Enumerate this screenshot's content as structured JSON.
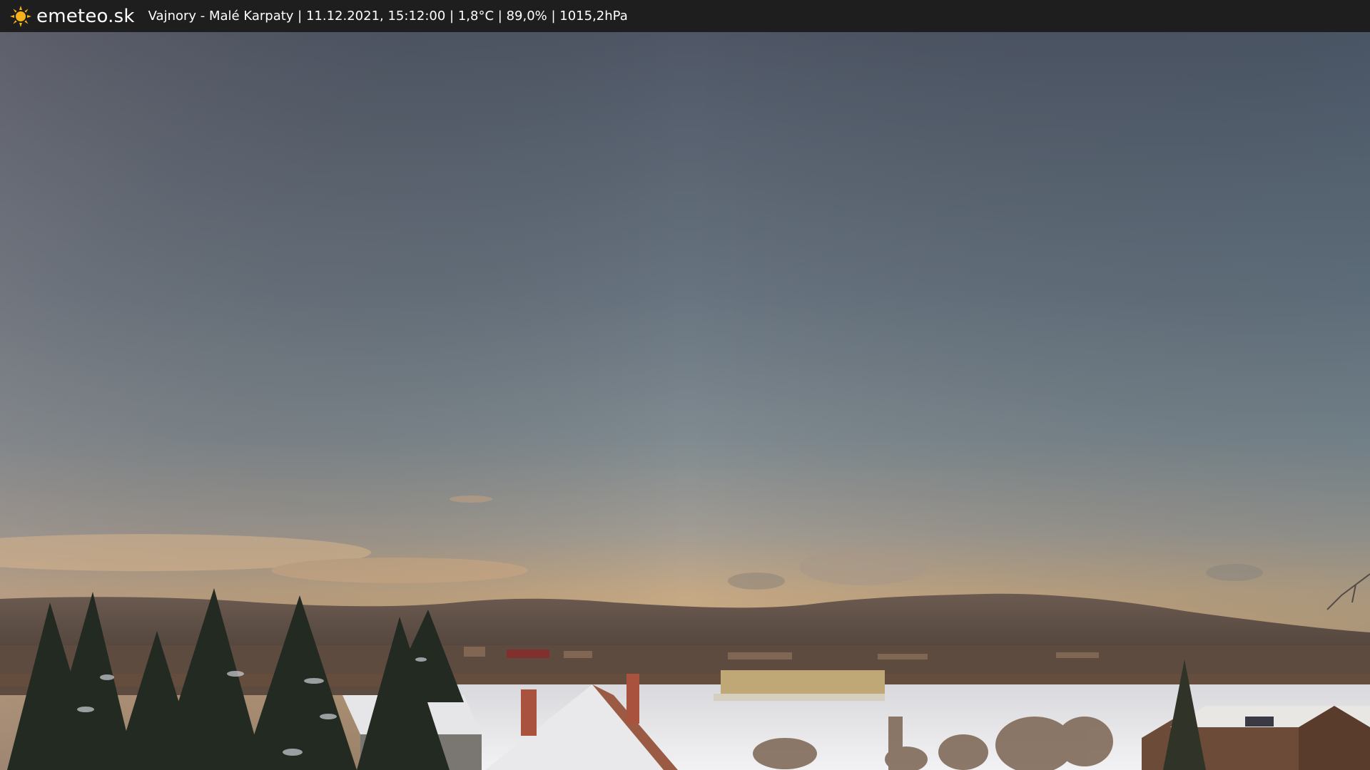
{
  "header": {
    "site_name": "emeteo.sk",
    "logo_icon": "sun-icon",
    "location": "Vajnory - Malé Karpaty",
    "datetime": "11.12.2021, 15:12:00",
    "temperature": "1,8°C",
    "humidity": "89,0%",
    "pressure": "1015,2hPa",
    "separator": " | "
  },
  "colors": {
    "bar_bg": "#1e1e1e",
    "sun": "#f5b21b",
    "sky_top": "#4f5766",
    "sky_mid": "#6f7f8a",
    "sky_horizon": "#c9a880"
  }
}
